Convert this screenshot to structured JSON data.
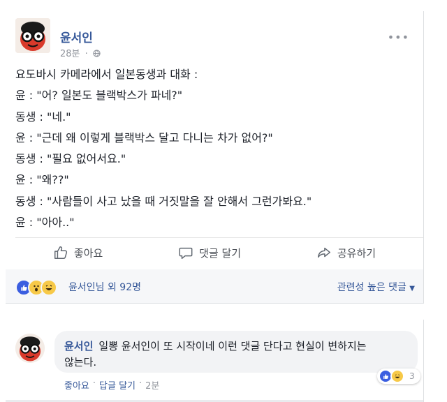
{
  "post": {
    "author": "윤서인",
    "time": "28분",
    "privacy_icon": "globe-icon",
    "more_icon": "more-horizontal-icon",
    "lines": [
      "요도바시 카메라에서 일본동생과 대화 :",
      "윤 : \"어? 일본도 블랙박스가 파네?\"",
      "동생 : \"네.\"",
      "윤 : \"근데 왜 이렇게 블랙박스 달고 다니는 차가 없어?\"",
      "동생 : \"필요 없어서요.\"",
      "윤 : \"왜??\"",
      "동생 : \"사람들이 사고 났을 때 거짓말을 잘 안해서 그런가봐요.\"",
      "윤 : \"아아..\""
    ]
  },
  "actions": {
    "like": "좋아요",
    "comment": "댓글 달기",
    "share": "공유하기"
  },
  "reactions": {
    "count_text": "윤서인님 외 92명",
    "sort_label": "관련성 높은 댓글"
  },
  "comment": {
    "author": "윤서인",
    "text_line1": "일뽕 윤서인이 또 시작이네 이런 댓글 단다고 현실이 변하지는",
    "text_line2": "않는다.",
    "reaction_count": "3",
    "like_label": "좋아요",
    "reply_label": "답글 달기",
    "time": "2분"
  },
  "colors": {
    "link": "#365899",
    "secondary": "#90949c",
    "like_blue": "#3b5ee0",
    "emoji_yellow": "#f7c948"
  }
}
